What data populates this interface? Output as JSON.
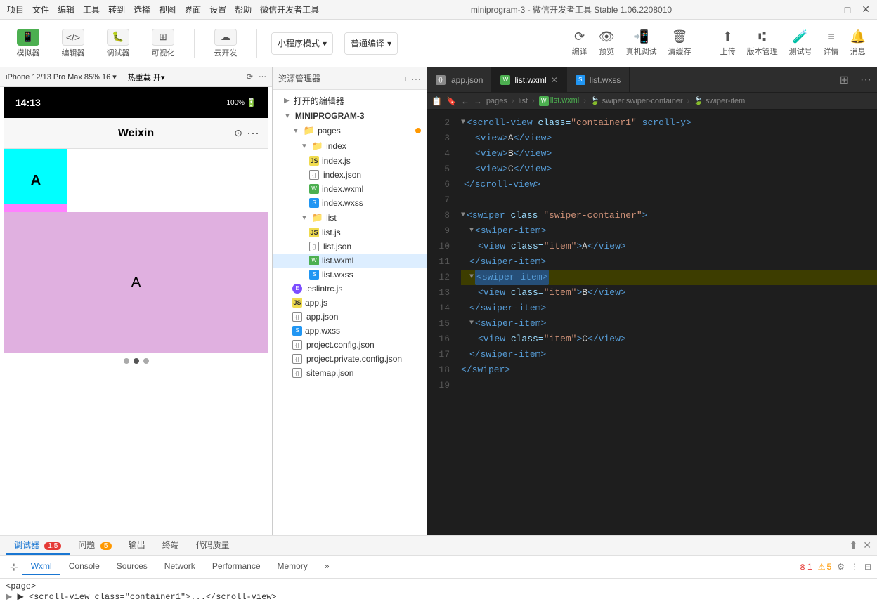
{
  "titleBar": {
    "menuItems": [
      "项目",
      "文件",
      "编辑",
      "工具",
      "转到",
      "选择",
      "视图",
      "界面",
      "设置",
      "帮助",
      "微信开发者工具"
    ],
    "title": "miniprogram-3 - 微信开发者工具 Stable 1.06.2208010",
    "windowControls": [
      "—",
      "□",
      "✕"
    ]
  },
  "toolbar": {
    "simulator_label": "模拟器",
    "editor_label": "编辑器",
    "debugger_label": "调试器",
    "visible_label": "可视化",
    "cloud_label": "云开发",
    "mode_label": "小程序模式",
    "compile_label": "普通编译",
    "compile_btn": "编译",
    "preview_btn": "预览",
    "realtest_btn": "真机调试",
    "clearcache_btn": "清缓存",
    "upload_btn": "上传",
    "version_btn": "版本管理",
    "test_btn": "测试号",
    "detail_btn": "详情",
    "notify_btn": "消息"
  },
  "simulator": {
    "device": "iPhone 12/13 Pro Max 85% 16 ▾",
    "hotreload": "热重载 开▾",
    "zoom": "100%",
    "battery": "🔋",
    "time": "14:13",
    "weixin_title": "Weixin",
    "block_a": "A",
    "block_purple_a": "A"
  },
  "filePanel": {
    "title": "资源管理器",
    "openedTitle": "打开的编辑器",
    "projectName": "MINIPROGRAM-3",
    "files": [
      {
        "name": "pages",
        "type": "folder",
        "indent": 1,
        "expanded": true
      },
      {
        "name": "index",
        "type": "folder",
        "indent": 2,
        "expanded": true
      },
      {
        "name": "index.js",
        "type": "js",
        "indent": 3
      },
      {
        "name": "index.json",
        "type": "json",
        "indent": 3
      },
      {
        "name": "index.wxml",
        "type": "wxml",
        "indent": 3
      },
      {
        "name": "index.wxss",
        "type": "wxss",
        "indent": 3
      },
      {
        "name": "list",
        "type": "folder",
        "indent": 2,
        "expanded": true
      },
      {
        "name": "list.js",
        "type": "js",
        "indent": 3
      },
      {
        "name": "list.json",
        "type": "json",
        "indent": 3
      },
      {
        "name": "list.wxml",
        "type": "wxml",
        "indent": 3,
        "selected": true
      },
      {
        "name": "list.wxss",
        "type": "wxss",
        "indent": 3
      },
      {
        "name": ".eslintrc.js",
        "type": "eslint",
        "indent": 1
      },
      {
        "name": "app.js",
        "type": "js",
        "indent": 1
      },
      {
        "name": "app.json",
        "type": "json",
        "indent": 1,
        "hasDot": true
      },
      {
        "name": "app.wxss",
        "type": "wxss",
        "indent": 1
      },
      {
        "name": "project.config.json",
        "type": "json",
        "indent": 1
      },
      {
        "name": "project.private.config.json",
        "type": "json",
        "indent": 1
      },
      {
        "name": "sitemap.json",
        "type": "json",
        "indent": 1
      }
    ]
  },
  "editor": {
    "tabs": [
      {
        "name": "app.json",
        "type": "json",
        "active": false
      },
      {
        "name": "list.wxml",
        "type": "wxml",
        "active": true
      },
      {
        "name": "list.wxss",
        "type": "wxss",
        "active": false
      }
    ],
    "breadcrumb": [
      "pages",
      ">",
      "list",
      ">",
      "list.wxml",
      ">",
      "swiper.swiper-container",
      ">",
      "swiper-item"
    ],
    "lines": [
      {
        "num": "2",
        "code": "  <scroll-view class=\"container1\" scroll-y>",
        "tags": [
          "scroll-view"
        ],
        "fold": true
      },
      {
        "num": "3",
        "code": "    <view>A</view>"
      },
      {
        "num": "4",
        "code": "    <view>B</view>"
      },
      {
        "num": "5",
        "code": "    <view>C</view>"
      },
      {
        "num": "6",
        "code": "  </scroll-view>"
      },
      {
        "num": "7",
        "code": ""
      },
      {
        "num": "8",
        "code": "  <swiper class=\"swiper-container\">",
        "fold": true
      },
      {
        "num": "9",
        "code": "    <swiper-item>",
        "fold": true
      },
      {
        "num": "10",
        "code": "      <view class=\"item\">A</view>"
      },
      {
        "num": "11",
        "code": "    </swiper-item>"
      },
      {
        "num": "12",
        "code": "    <swiper-item>",
        "highlighted": true,
        "fold": true
      },
      {
        "num": "13",
        "code": "      <view class=\"item\">B</view>"
      },
      {
        "num": "14",
        "code": "    </swiper-item>"
      },
      {
        "num": "15",
        "code": "    <swiper-item>",
        "fold": true
      },
      {
        "num": "16",
        "code": "      <view class=\"item\">C</view>"
      },
      {
        "num": "17",
        "code": "    </swiper-item>"
      },
      {
        "num": "18",
        "code": "  </swiper>"
      },
      {
        "num": "19",
        "code": ""
      }
    ]
  },
  "bottomPanel": {
    "tabs": [
      {
        "label": "调试器",
        "badge": "1,5",
        "badgeColor": "red"
      },
      {
        "label": "问题",
        "badge": "5",
        "badgeColor": "yellow"
      },
      {
        "label": "输出"
      },
      {
        "label": "终端"
      },
      {
        "label": "代码质量"
      }
    ],
    "devtoolsTabs": [
      {
        "label": "Wxml",
        "active": true
      },
      {
        "label": "Console"
      },
      {
        "label": "Sources"
      },
      {
        "label": "Network"
      },
      {
        "label": "Performance"
      },
      {
        "label": "Memory"
      },
      {
        "label": "···"
      }
    ],
    "errorCount": "1",
    "warnCount": "5",
    "code1": "<page>",
    "code2": "  ▶ <scroll-view class=\"container1\">...</scroll-view>"
  }
}
